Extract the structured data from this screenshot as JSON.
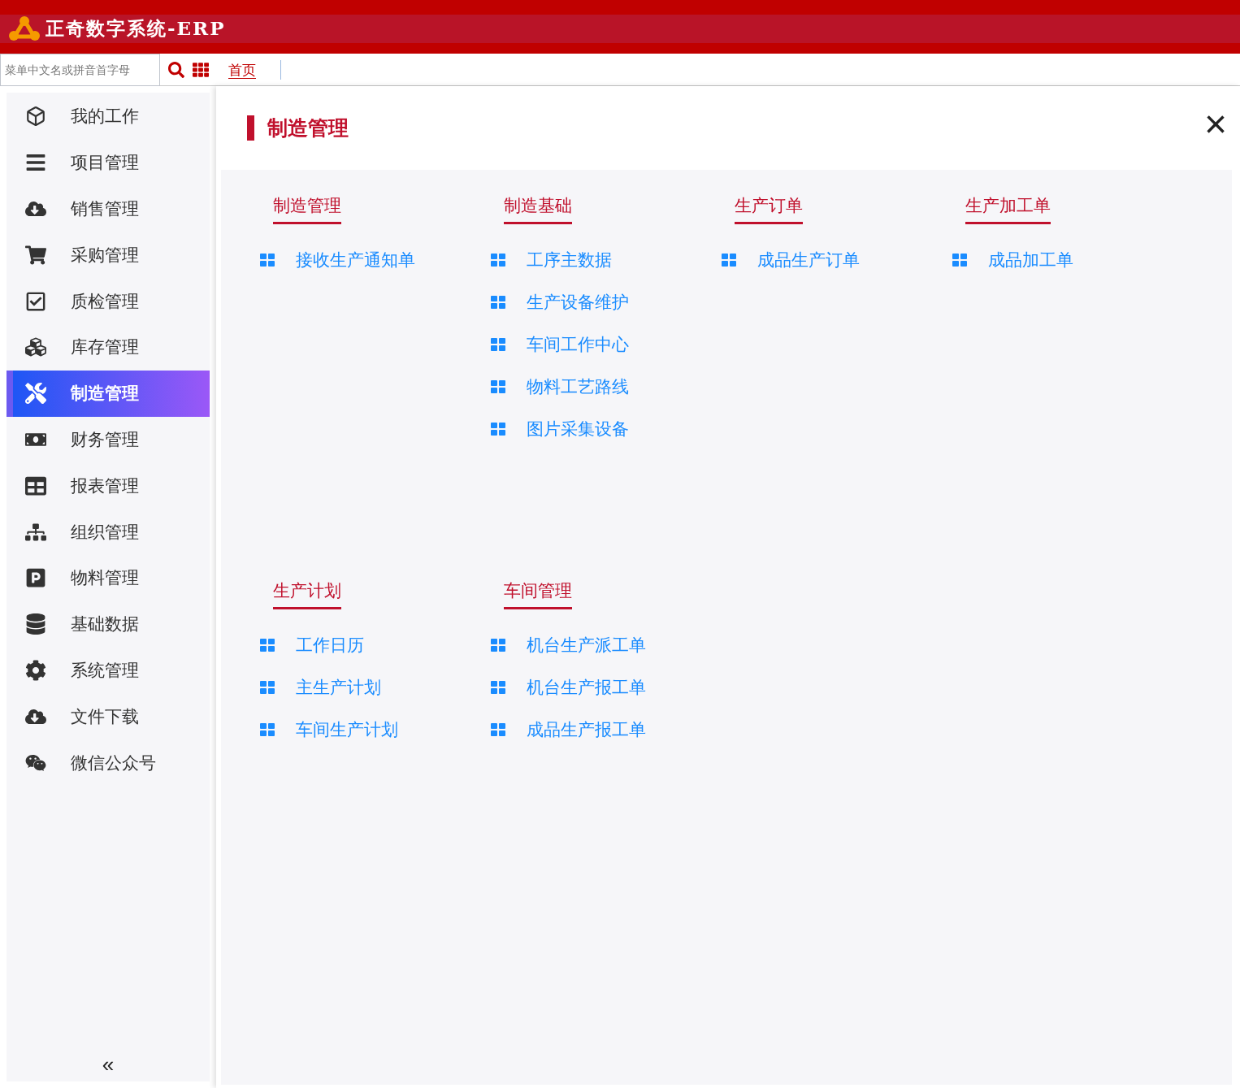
{
  "app_title": "正奇数字系统-ERP",
  "search": {
    "placeholder": "菜单中文名或拼音首字母"
  },
  "tabs": [
    {
      "label": "首页",
      "selected": true
    }
  ],
  "sidebar": {
    "items": [
      {
        "label": "我的工作",
        "selected": false
      },
      {
        "label": "项目管理",
        "selected": false
      },
      {
        "label": "销售管理",
        "selected": false
      },
      {
        "label": "采购管理",
        "selected": false
      },
      {
        "label": "质检管理",
        "selected": false
      },
      {
        "label": "库存管理",
        "selected": false
      },
      {
        "label": "制造管理",
        "selected": true
      },
      {
        "label": "财务管理",
        "selected": false
      },
      {
        "label": "报表管理",
        "selected": false
      },
      {
        "label": "组织管理",
        "selected": false
      },
      {
        "label": "物料管理",
        "selected": false
      },
      {
        "label": "基础数据",
        "selected": false
      },
      {
        "label": "系统管理",
        "selected": false
      },
      {
        "label": "文件下载",
        "selected": false
      },
      {
        "label": "微信公众号",
        "selected": false
      }
    ],
    "collapse": "«"
  },
  "panel": {
    "title": "制造管理",
    "close": "×",
    "rows": [
      [
        {
          "heading": "制造管理",
          "items": [
            "接收生产通知单"
          ]
        },
        {
          "heading": "制造基础",
          "items": [
            "工序主数据",
            "生产设备维护",
            "车间工作中心",
            "物料工艺路线",
            "图片采集设备"
          ]
        },
        {
          "heading": "生产订单",
          "items": [
            "成品生产订单"
          ]
        },
        {
          "heading": "生产加工单",
          "items": [
            "成品加工单"
          ]
        }
      ],
      [
        {
          "heading": "生产计划",
          "items": [
            "工作日历",
            "主生产计划",
            "车间生产计划"
          ]
        },
        {
          "heading": "车间管理",
          "items": [
            "机台生产派工单",
            "机台生产报工单",
            "成品生产报工单"
          ]
        }
      ]
    ]
  }
}
